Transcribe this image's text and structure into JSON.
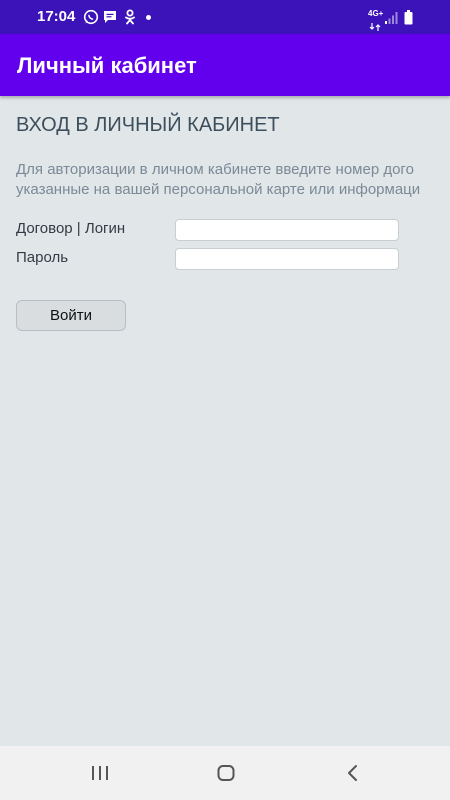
{
  "status_bar": {
    "time": "17:04",
    "network": "4G+",
    "icons": [
      "whatsapp-icon",
      "message-icon",
      "odnoklassniki-icon",
      "notification-dot",
      "signal-icon",
      "battery-icon"
    ]
  },
  "app_bar": {
    "title": "Личный кабинет",
    "color": "#6200ee"
  },
  "login": {
    "heading": "ВХОД В ЛИЧНЫЙ КАБИНЕТ",
    "description_line1": "Для авторизации в личном кабинете введите номер дого",
    "description_line2": "указанные на вашей персональной карте или информаци",
    "login_label": "Договор | Логин",
    "login_value": "",
    "password_label": "Пароль",
    "password_value": "",
    "submit_label": "Войти"
  },
  "nav_bar": {
    "buttons": [
      "recents-icon",
      "home-icon",
      "back-icon"
    ]
  }
}
